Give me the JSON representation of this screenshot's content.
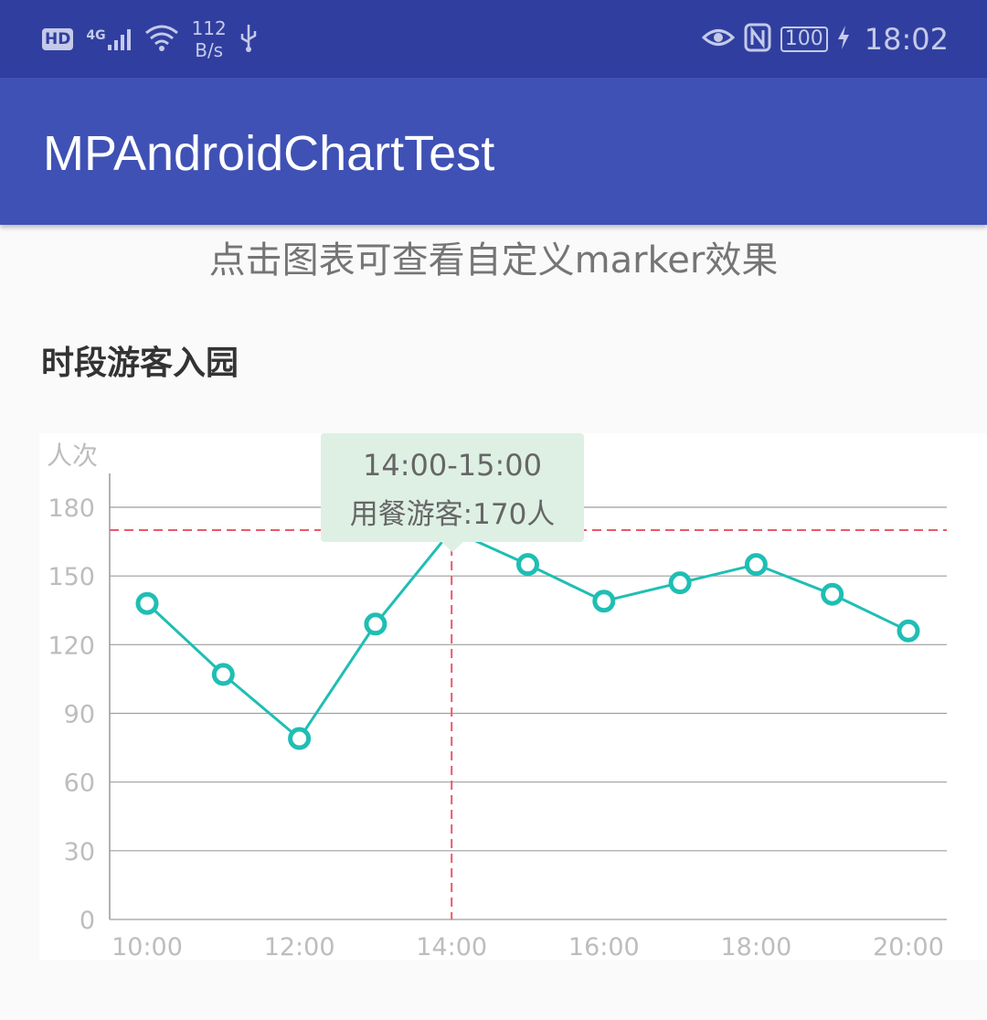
{
  "status_bar": {
    "hd": "HD",
    "network": "4G",
    "speed_value": "112",
    "speed_unit": "B/s",
    "battery": "100",
    "time": "18:02"
  },
  "app_bar": {
    "title": "MPAndroidChartTest"
  },
  "hint": "点击图表可查看自定义marker效果",
  "section_title": "时段游客入园",
  "chart_data": {
    "type": "line",
    "title": "",
    "xlabel": "",
    "ylabel": "人次",
    "ylim": [
      0,
      195
    ],
    "yticks": [
      0,
      30,
      60,
      90,
      120,
      150,
      180
    ],
    "x": [
      "10:00",
      "11:00",
      "12:00",
      "13:00",
      "14:00",
      "15:00",
      "16:00",
      "17:00",
      "18:00",
      "19:00",
      "20:00"
    ],
    "x_tick_labels": [
      "10:00",
      "12:00",
      "14:00",
      "16:00",
      "18:00",
      "20:00"
    ],
    "series": [
      {
        "values": [
          138,
          107,
          79,
          129,
          170,
          155,
          139,
          147,
          155,
          142,
          126
        ]
      }
    ],
    "highlight": {
      "index": 4,
      "value": 170
    },
    "grid": true,
    "line_color": "#1fbeb4",
    "highlight_color": "#e85a6a"
  },
  "marker": {
    "time_range": "14:00-15:00",
    "label": "用餐游客:170人"
  }
}
